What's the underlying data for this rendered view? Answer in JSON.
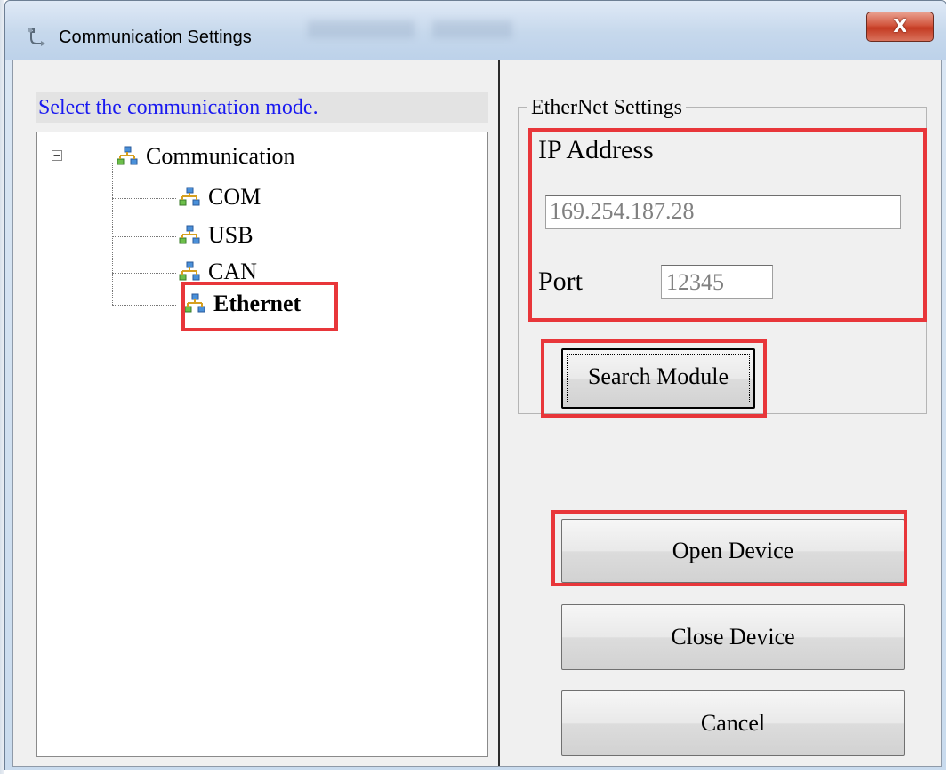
{
  "window": {
    "title": "Communication Settings",
    "close_glyph": "X",
    "app_icon": "wrench-cable-icon"
  },
  "left_panel": {
    "instruction": "Select the communication mode.",
    "tree": {
      "root": {
        "label": "Communication",
        "expanded": true,
        "expander_glyph": "−",
        "icon": "network-icon"
      },
      "children": [
        {
          "label": "COM",
          "icon": "network-icon"
        },
        {
          "label": "USB",
          "icon": "network-icon"
        },
        {
          "label": "CAN",
          "icon": "network-icon"
        },
        {
          "label": "Ethernet",
          "icon": "network-icon",
          "selected": true
        }
      ]
    }
  },
  "right_panel": {
    "group_title": "EtherNet Settings",
    "ip_label": "IP Address",
    "ip_value": "169.254.187.28",
    "port_label": "Port",
    "port_value": "12345",
    "search_button": "Search Module",
    "open_button": "Open Device",
    "close_button": "Close Device",
    "cancel_button": "Cancel"
  },
  "colors": {
    "highlight": "#e8363a",
    "instruction_text": "#1a1af0",
    "disabled_text": "#808080"
  }
}
